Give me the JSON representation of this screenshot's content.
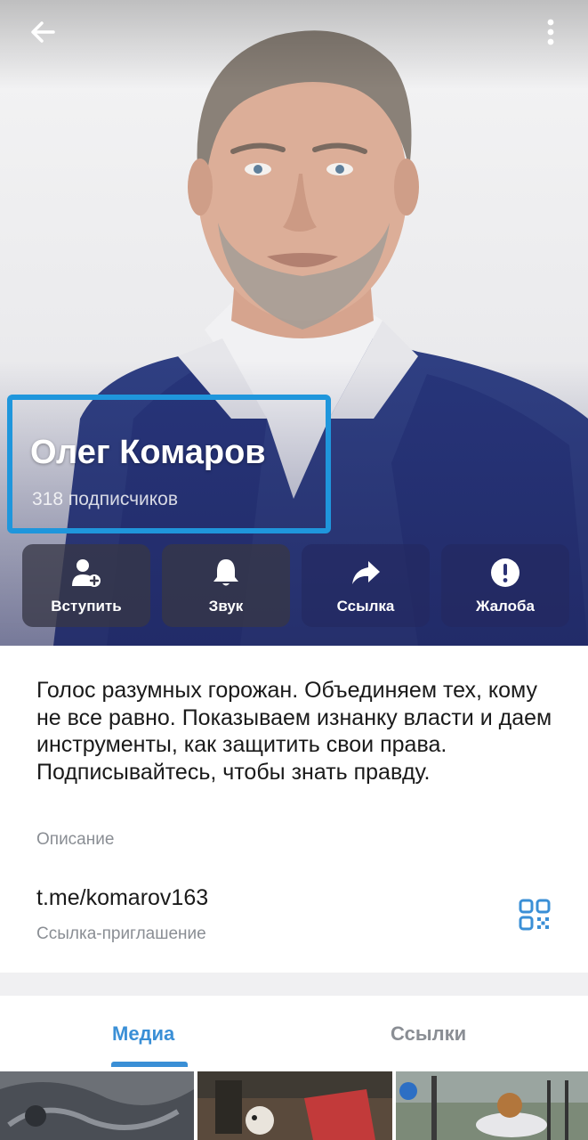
{
  "channel": {
    "name": "Олег Комаров",
    "subscribers": "318 подписчиков"
  },
  "actions": [
    {
      "label": "Вступить",
      "icon": "add-user-icon"
    },
    {
      "label": "Звук",
      "icon": "bell-icon"
    },
    {
      "label": "Ссылка",
      "icon": "share-arrow-icon"
    },
    {
      "label": "Жалоба",
      "icon": "exclamation-icon"
    }
  ],
  "info": {
    "description": "Голос разумных горожан. Объединяем тех, кому не все равно. Показываем изнанку власти и даем инструменты, как защитить свои права. Подписывайтесь, чтобы знать правду.",
    "description_caption": "Описание",
    "link": "t.me/komarov163",
    "link_caption": "Ссылка-приглашение"
  },
  "tabs": [
    {
      "label": "Медиа",
      "active": true
    },
    {
      "label": "Ссылки",
      "active": false
    }
  ],
  "colors": {
    "accent": "#3a8fd6",
    "highlight_border": "#1f96dc",
    "caption": "#8a8e94",
    "suit_navy": "#2a3a7a"
  }
}
